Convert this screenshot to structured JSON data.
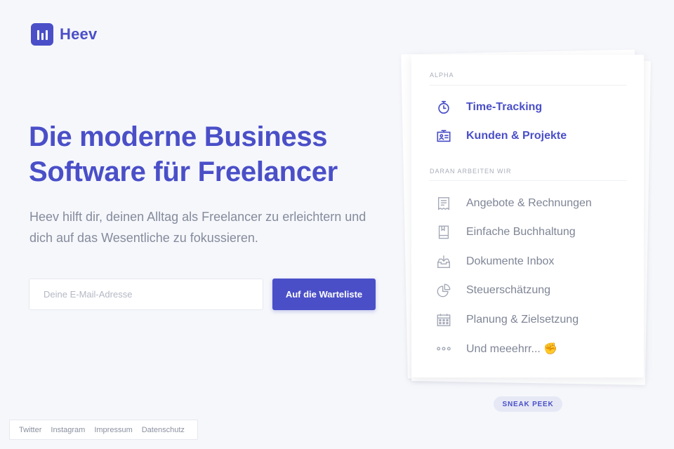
{
  "brand": {
    "name": "Heev",
    "color": "#4a4fc8"
  },
  "hero": {
    "headline_line1": "Die moderne Business",
    "headline_line2": "Software für Freelancer",
    "subline_line1": "Heev hilft dir, deinen Alltag als Freelancer zu erleichtern und",
    "subline_line2": "dich auf das Wesentliche zu fokussieren."
  },
  "signup": {
    "email_placeholder": "Deine E-Mail-Adresse",
    "email_value": "",
    "button_label": "Auf die Warteliste"
  },
  "card": {
    "alpha_label": "ALPHA",
    "alpha_items": [
      {
        "label": "Time-Tracking",
        "icon": "stopwatch-icon"
      },
      {
        "label": "Kunden & Projekte",
        "icon": "contact-card-icon"
      }
    ],
    "wip_label": "DARAN ARBEITEN WIR",
    "wip_items": [
      {
        "label": "Angebote & Rechnungen",
        "icon": "receipt-icon"
      },
      {
        "label": "Einfache Buchhaltung",
        "icon": "book-icon"
      },
      {
        "label": "Dokumente Inbox",
        "icon": "inbox-download-icon"
      },
      {
        "label": "Steuerschätzung",
        "icon": "pie-chart-icon"
      },
      {
        "label": "Planung & Zielsetzung",
        "icon": "calendar-icon"
      },
      {
        "label": "Und meeehrr... ✊",
        "icon": "more-dots-icon"
      }
    ]
  },
  "badge": {
    "label": "SNEAK PEEK"
  },
  "footer": {
    "links": [
      "Twitter",
      "Instagram",
      "Impressum",
      "Datenschutz"
    ]
  }
}
